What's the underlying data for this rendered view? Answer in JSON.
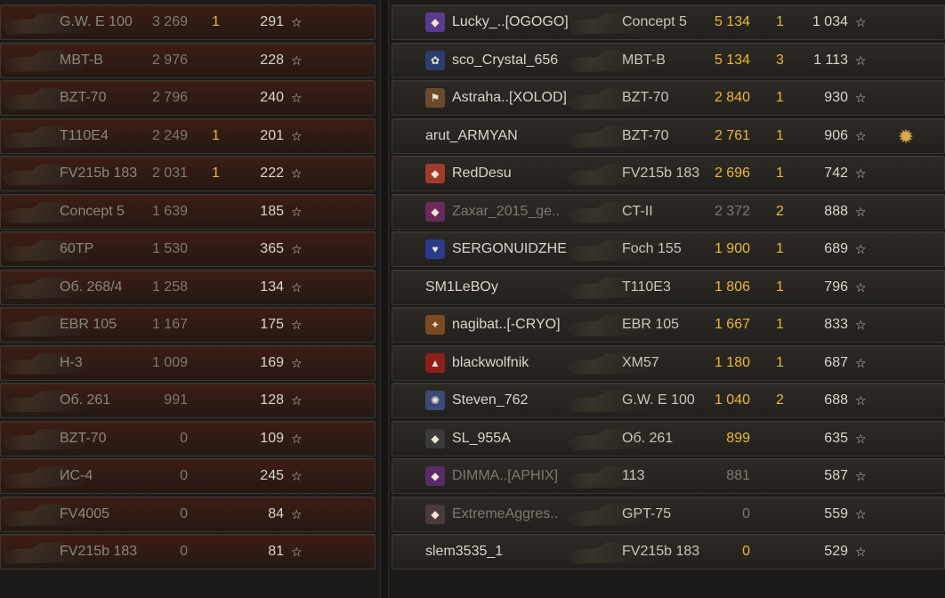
{
  "team_left": [
    {
      "vehicle": "G.W. E 100",
      "damage": "3 269",
      "kills": "1",
      "xp": "291",
      "dead": true
    },
    {
      "vehicle": "MBT-B",
      "damage": "2 976",
      "kills": "",
      "xp": "228",
      "dead": true
    },
    {
      "vehicle": "BZT-70",
      "damage": "2 796",
      "kills": "",
      "xp": "240",
      "dead": true
    },
    {
      "vehicle": "T110E4",
      "damage": "2 249",
      "kills": "1",
      "xp": "201",
      "dead": true
    },
    {
      "vehicle": "FV215b 183",
      "damage": "2 031",
      "kills": "1",
      "xp": "222",
      "dead": true
    },
    {
      "vehicle": "Concept 5",
      "damage": "1 639",
      "kills": "",
      "xp": "185",
      "dead": true
    },
    {
      "vehicle": "60TP",
      "damage": "1 530",
      "kills": "",
      "xp": "365",
      "dead": true
    },
    {
      "vehicle": "Об. 268/4",
      "damage": "1 258",
      "kills": "",
      "xp": "134",
      "dead": true
    },
    {
      "vehicle": "EBR 105",
      "damage": "1 167",
      "kills": "",
      "xp": "175",
      "dead": true
    },
    {
      "vehicle": "H-3",
      "damage": "1 009",
      "kills": "",
      "xp": "169",
      "dead": true
    },
    {
      "vehicle": "Об. 261",
      "damage": "991",
      "kills": "",
      "xp": "128",
      "dead": true
    },
    {
      "vehicle": "BZT-70",
      "damage": "0",
      "kills": "",
      "xp": "109",
      "dead": true
    },
    {
      "vehicle": "ИС-4",
      "damage": "0",
      "kills": "",
      "xp": "245",
      "dead": true
    },
    {
      "vehicle": "FV4005",
      "damage": "0",
      "kills": "",
      "xp": "84",
      "dead": true
    },
    {
      "vehicle": "FV215b 183",
      "damage": "0",
      "kills": "",
      "xp": "81",
      "dead": true
    }
  ],
  "team_right": [
    {
      "player": "Lucky_..[OGOGO]",
      "vehicle": "Concept 5",
      "damage": "5 134",
      "kills": "1",
      "xp": "1 034",
      "badge": "◆",
      "badge_color": "#5a3a8c",
      "dim": false
    },
    {
      "player": "sco_Crystal_656",
      "vehicle": "MBT-B",
      "damage": "5 134",
      "kills": "3",
      "xp": "1 113",
      "badge": "✿",
      "badge_color": "#2a3f6e",
      "dim": false
    },
    {
      "player": "Astraha..[XOLOD]",
      "vehicle": "BZT-70",
      "damage": "2 840",
      "kills": "1",
      "xp": "930",
      "badge": "⚑",
      "badge_color": "#6a4a2a",
      "dim": false
    },
    {
      "player": "arut_ARMYAN",
      "vehicle": "BZT-70",
      "damage": "2 761",
      "kills": "1",
      "xp": "906",
      "badge": "",
      "badge_color": "",
      "dim": false,
      "medal": true
    },
    {
      "player": "RedDesu",
      "vehicle": "FV215b 183",
      "damage": "2 696",
      "kills": "1",
      "xp": "742",
      "badge": "◆",
      "badge_color": "#a03a2a",
      "dim": false
    },
    {
      "player": "Zaxar_2015_ge..",
      "vehicle": "CT-II",
      "damage": "2 372",
      "kills": "2",
      "xp": "888",
      "badge": "◆",
      "badge_color": "#6a2a5a",
      "dim": true
    },
    {
      "player": "SERGONUIDZHE",
      "vehicle": "Foch 155",
      "damage": "1 900",
      "kills": "1",
      "xp": "689",
      "badge": "♥",
      "badge_color": "#2a3a8c",
      "dim": false
    },
    {
      "player": "SM1LeBOy",
      "vehicle": "T110E3",
      "damage": "1 806",
      "kills": "1",
      "xp": "796",
      "badge": "",
      "badge_color": "",
      "dim": false
    },
    {
      "player": "nagibat..[-CRYO]",
      "vehicle": "EBR 105",
      "damage": "1 667",
      "kills": "1",
      "xp": "833",
      "badge": "✦",
      "badge_color": "#7a4a20",
      "dim": false
    },
    {
      "player": "blackwolfnik",
      "vehicle": "XM57",
      "damage": "1 180",
      "kills": "1",
      "xp": "687",
      "badge": "▲",
      "badge_color": "#8c1f1a",
      "dim": false
    },
    {
      "player": "Steven_762",
      "vehicle": "G.W. E 100",
      "damage": "1 040",
      "kills": "2",
      "xp": "688",
      "badge": "✺",
      "badge_color": "#3a4a7a",
      "dim": false
    },
    {
      "player": "SL_955A",
      "vehicle": "Об. 261",
      "damage": "899",
      "kills": "",
      "xp": "635",
      "badge": "◆",
      "badge_color": "#3a3a3a",
      "dim": false
    },
    {
      "player": "DIMMA..[APHIX]",
      "vehicle": "113",
      "damage": "881",
      "kills": "",
      "xp": "587",
      "badge": "◆",
      "badge_color": "#5a2a6a",
      "dim": true
    },
    {
      "player": "ExtremeAggres..",
      "vehicle": "GPT-75",
      "damage": "0",
      "kills": "",
      "xp": "559",
      "badge": "◆",
      "badge_color": "#4a3a3a",
      "dim": true
    },
    {
      "player": "slem3535_1",
      "vehicle": "FV215b 183",
      "damage": "0",
      "kills": "",
      "xp": "529",
      "badge": "",
      "badge_color": "",
      "dim": false
    }
  ],
  "icons": {
    "star": "☆",
    "medal": "✹"
  },
  "colors": {
    "damage_highlight": "#e8b838",
    "dead_row": "#3c1d15"
  }
}
